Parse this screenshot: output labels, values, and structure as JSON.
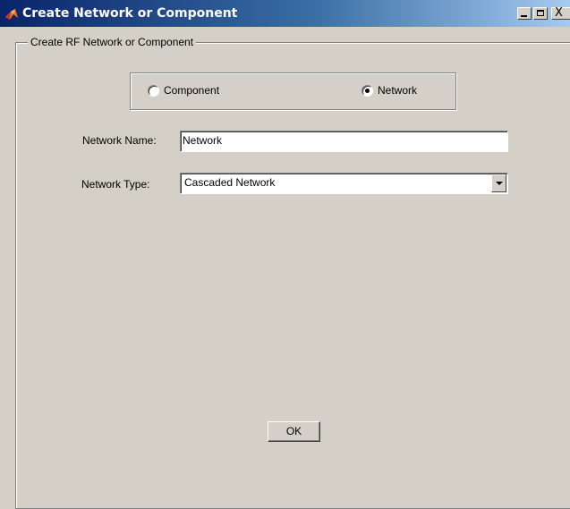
{
  "window": {
    "title": "Create Network or Component",
    "controls": {
      "minimize_icon": "minimize-icon",
      "maximize_icon": "maximize-icon",
      "close_icon": "close-icon",
      "close_glyph": "X"
    }
  },
  "group": {
    "label": "Create RF Network or Component"
  },
  "type_choice": {
    "component_label": "Component",
    "network_label": "Network",
    "selected": "Network"
  },
  "form": {
    "name_label": "Network Name:",
    "name_value": "Network",
    "type_label": "Network Type:",
    "type_value": "Cascaded Network"
  },
  "buttons": {
    "ok_label": "OK"
  }
}
